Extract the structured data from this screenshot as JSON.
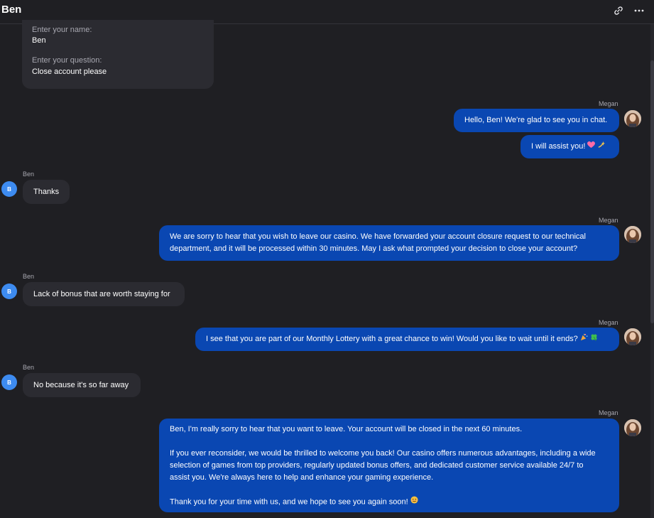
{
  "header": {
    "title": "Ben",
    "link_icon": "link-icon",
    "more_icon": "more-horizontal-icon"
  },
  "form": {
    "name_label": "Enter your name:",
    "name_value": "Ben",
    "question_label": "Enter your question:",
    "question_value": "Close account please"
  },
  "agent_name": "Megan",
  "user_name": "Ben",
  "user_initial": "B",
  "messages": {
    "m1": "Hello, Ben! We're glad to see you in chat.",
    "m2": "I will assist you!",
    "m3": "Thanks",
    "m4_line1": "We are sorry to hear that you wish to leave our casino. We have forwarded your account closure request to our technical",
    "m4_line2": "department, and it will be processed within 30 minutes. May I ask what prompted your decision to close your account?",
    "m5": "Lack of bonus that are worth staying for",
    "m6": "I see that you are part of our Monthly Lottery with a great chance to win! Would you like to wait until it ends?",
    "m7": "No because it's so far away",
    "m8_p1": "Ben, I'm really sorry to hear that you want to leave. Your account will be closed in the next 60 minutes.",
    "m8_p2_l1": "If you ever reconsider, we would be thrilled to welcome you back! Our casino offers numerous advantages, including a wide",
    "m8_p2_l2": "selection of games from top providers, regularly updated bonus offers, and dedicated customer service available 24/7 to",
    "m8_p2_l3": "assist you. We're always here to help and enhance your gaming experience.",
    "m8_p3": "Thank you for your time with us, and we hope to see you again soon!"
  },
  "colors": {
    "agent_bubble": "#0a47b2",
    "user_bubble": "#2b2b31",
    "background": "#1f1f23",
    "user_avatar": "#3d8bf0"
  }
}
